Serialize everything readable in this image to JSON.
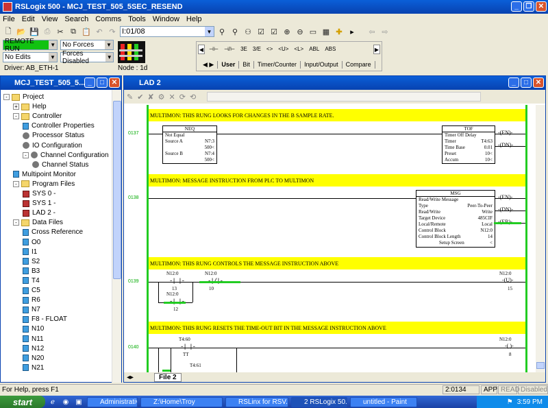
{
  "app": {
    "title": "RSLogix 500 - MCJ_TEST_505_5SEC_RESEND"
  },
  "menu": [
    "File",
    "Edit",
    "View",
    "Search",
    "Comms",
    "Tools",
    "Window",
    "Help"
  ],
  "toolbar": {
    "address_value": "I:01/08"
  },
  "status": {
    "mode": "REMOTE RUN",
    "forces": "No Forces",
    "edits": "No Edits",
    "forces_enabled": "Forces Disabled",
    "driver": "Driver: AB_ETH-1",
    "node": "Node : 1d"
  },
  "instruction_bar": {
    "items": [
      "⊣⊢",
      "⊣/⊢",
      "3E",
      "3/E",
      "<>",
      "<U>",
      "<L>",
      "ABL",
      "ABS"
    ],
    "tabs": [
      "User",
      "Bit",
      "Timer/Counter",
      "Input/Output",
      "Compare"
    ]
  },
  "project": {
    "title": "MCJ_TEST_505_5...",
    "tree": [
      {
        "label": "Project",
        "level": 0,
        "icon": "folder",
        "expander": "-"
      },
      {
        "label": "Help",
        "level": 1,
        "icon": "folder",
        "expander": "+"
      },
      {
        "label": "Controller",
        "level": 1,
        "icon": "folder",
        "expander": "-"
      },
      {
        "label": "Controller Properties",
        "level": 2,
        "icon": "file"
      },
      {
        "label": "Processor Status",
        "level": 2,
        "icon": "gear"
      },
      {
        "label": "IO Configuration",
        "level": 2,
        "icon": "gear"
      },
      {
        "label": "Channel Configuration",
        "level": 2,
        "icon": "gear",
        "expander": "-"
      },
      {
        "label": "Channel Status",
        "level": 3,
        "icon": "gear"
      },
      {
        "label": "Multipoint Monitor",
        "level": 1,
        "icon": "file"
      },
      {
        "label": "Program Files",
        "level": 1,
        "icon": "folder",
        "expander": "-"
      },
      {
        "label": "SYS 0 -",
        "level": 2,
        "icon": "prog"
      },
      {
        "label": "SYS 1 -",
        "level": 2,
        "icon": "prog"
      },
      {
        "label": "LAD 2 -",
        "level": 2,
        "icon": "prog"
      },
      {
        "label": "Data Files",
        "level": 1,
        "icon": "folder",
        "expander": "-"
      },
      {
        "label": "Cross Reference",
        "level": 2,
        "icon": "file"
      },
      {
        "label": "O0",
        "level": 2,
        "icon": "file"
      },
      {
        "label": "I1",
        "level": 2,
        "icon": "file"
      },
      {
        "label": "S2",
        "level": 2,
        "icon": "file"
      },
      {
        "label": "B3",
        "level": 2,
        "icon": "file"
      },
      {
        "label": "T4",
        "level": 2,
        "icon": "file"
      },
      {
        "label": "C5",
        "level": 2,
        "icon": "file"
      },
      {
        "label": "R6",
        "level": 2,
        "icon": "file"
      },
      {
        "label": "N7",
        "level": 2,
        "icon": "file"
      },
      {
        "label": "F8 - FLOAT",
        "level": 2,
        "icon": "file"
      },
      {
        "label": "N10",
        "level": 2,
        "icon": "file"
      },
      {
        "label": "N11",
        "level": 2,
        "icon": "file"
      },
      {
        "label": "N12",
        "level": 2,
        "icon": "file"
      },
      {
        "label": "N20",
        "level": 2,
        "icon": "file"
      },
      {
        "label": "N21",
        "level": 2,
        "icon": "file"
      }
    ]
  },
  "lad": {
    "title": "LAD 2",
    "file_tab": "File 2",
    "rungs": {
      "r137": {
        "num": "0137",
        "comment": "MULTIMON: THIS RUNG LOOKS FOR CHANGES IN THE B SAMPLE RATE.",
        "neq": {
          "name": "NEQ",
          "desc": "Not Equal",
          "srcA_label": "Source A",
          "srcA_tag": "N7:3",
          "srcA_val": "500<",
          "srcB_label": "Source B",
          "srcB_tag": "N7:4",
          "srcB_val": "500<"
        },
        "tof": {
          "name": "TOF",
          "desc": "Timer Off Delay",
          "timer_label": "Timer",
          "timer_val": "T4:63",
          "base_label": "Time Base",
          "base_val": "0.01",
          "preset_label": "Preset",
          "preset_val": "10<",
          "accum_label": "Accum",
          "accum_val": "10<"
        },
        "en": "EN",
        "dn": "DN"
      },
      "r138": {
        "num": "0138",
        "comment": "MULTIMON: MESSAGE INSTRUCTION FROM PLC TO MULTIMON",
        "msg": {
          "name": "MSG",
          "desc": "Read/Write Message",
          "type_label": "Type",
          "type_val": "Peer-To-Peer",
          "rw_label": "Read/Write",
          "rw_val": "Write",
          "dev_label": "Target Device",
          "dev_val": "485CIF",
          "lr_label": "Local/Remote",
          "lr_val": "Local",
          "cb_label": "Control Block",
          "cb_val": "N12:0",
          "cbl_label": "Control Block Length",
          "cbl_val": "14",
          "setup": "Setup Screen",
          "setup_arrow": "<"
        },
        "en": "EN",
        "dn": "DN",
        "er": "ER"
      },
      "r139": {
        "num": "0139",
        "comment": "MULTIMON: THIS RUNG CONTROLS THE MESSAGE INSTRUCTION ABOVE",
        "c1_tag": "N12:0",
        "c1_bit": "13",
        "c2_tag": "N12:0",
        "c2_bit": "10",
        "c3_tag": "N12:0",
        "c3_bit": "12",
        "coil_tag": "N12:0",
        "coil_bit": "15",
        "coil": "U"
      },
      "r140": {
        "num": "0140",
        "comment": "MULTIMON: THIS RUNG RESETS THE TIME-OUT BIT IN THE MESSAGE INSTRUCTION ABOVE",
        "c1_tag": "T4:60",
        "c1_bit": "TT",
        "c2_tag": "T4:61",
        "coil_tag": "N12:0",
        "coil_bit": "8"
      }
    }
  },
  "statusbar": {
    "help": "For Help, press F1",
    "pos": "2:0134",
    "app": "APP",
    "read": "READ",
    "disabled": "Disabled"
  },
  "taskbar": {
    "start": "start",
    "tasks": [
      "Administrative ...",
      "Z:\\Home\\Troy",
      "RSLinx for RSV...",
      "2 RSLogix 50...",
      "untitled - Paint"
    ],
    "clock": "3:59 PM"
  }
}
